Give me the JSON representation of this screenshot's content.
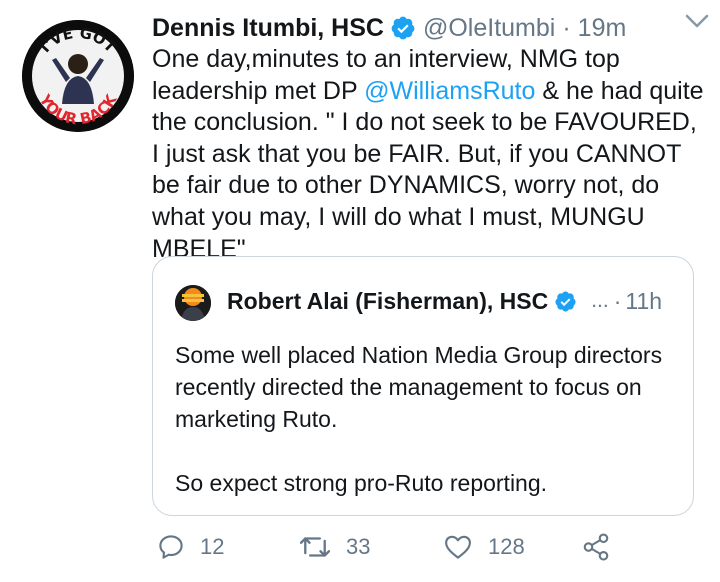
{
  "tweet": {
    "avatar_text_top": "I'VE GOT",
    "avatar_text_bottom": "YOUR BACK",
    "name": "Dennis Itumbi, HSC",
    "handle": "@OleItumbi",
    "separator": "·",
    "time": "19m",
    "text_parts": {
      "p1": "One day,minutes to an interview, NMG top leadership met DP ",
      "mention": "@WilliamsRuto",
      "p2": " & he had quite the conclusion. \" I do not seek to be FAVOURED, I just ask that you be FAIR. But, if you CANNOT be fair due to other DYNAMICS, worry not, do what you may, I will do what I must, MUNGU MBELE\""
    }
  },
  "quote": {
    "name": "Robert Alai (Fisherman), HSC",
    "ellipsis": "...",
    "separator": "·",
    "time": "11h",
    "paragraphs": [
      "Some well placed Nation Media Group directors recently directed the management to focus on marketing Ruto.",
      "So expect strong pro-Ruto reporting."
    ]
  },
  "actions": {
    "replies": "12",
    "retweets": "33",
    "likes": "128"
  },
  "colors": {
    "accent": "#1da1f2",
    "muted": "#657786",
    "text": "#14171a",
    "border": "#ccd6dd"
  }
}
